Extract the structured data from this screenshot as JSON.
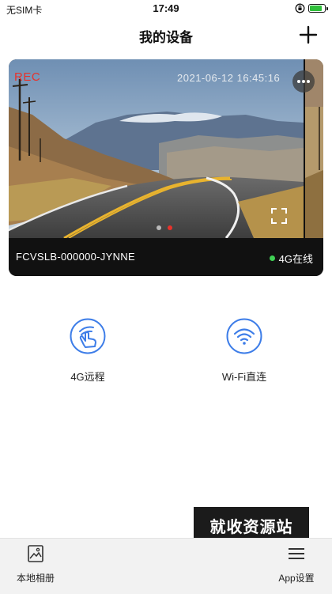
{
  "status_bar": {
    "carrier": "无SIM卡",
    "time": "17:49"
  },
  "header": {
    "title": "我的设备",
    "add_icon": "plus-icon"
  },
  "device_card": {
    "rec_label": "REC",
    "timestamp": "2021-06-12  16:45:16",
    "device_name": "FCVSLB-000000-JYNNE",
    "status_text": "4G在线",
    "status_color": "#3fd054",
    "carousel_count": 2,
    "carousel_active_index": 1,
    "dot_active_color": "#e8322b",
    "dot_inactive_color": "#b9b9b9"
  },
  "actions": [
    {
      "label": "4G远程",
      "icon": "remote-tap-icon"
    },
    {
      "label": "Wi-Fi直连",
      "icon": "wifi-icon"
    }
  ],
  "accent_color": "#3d7de8",
  "watermark": "就收资源站",
  "bottom_nav": {
    "items": [
      {
        "label": "本地相册",
        "icon": "album-icon"
      },
      {
        "label": "App设置",
        "icon": "menu-icon"
      }
    ]
  }
}
